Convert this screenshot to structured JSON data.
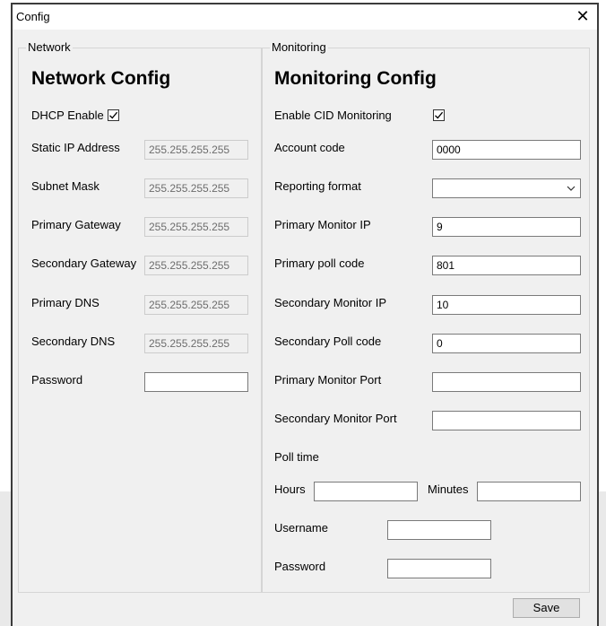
{
  "window": {
    "title": "Config"
  },
  "network": {
    "group_label": "Network",
    "heading": "Network Config",
    "dhcp_label": "DHCP Enable",
    "dhcp_checked": true,
    "fields": [
      {
        "label": "Static IP Address",
        "value": "255.255.255.255"
      },
      {
        "label": "Subnet Mask",
        "value": "255.255.255.255"
      },
      {
        "label": "Primary Gateway",
        "value": "255.255.255.255"
      },
      {
        "label": "Secondary Gateway",
        "value": "255.255.255.255"
      },
      {
        "label": "Primary DNS",
        "value": "255.255.255.255"
      },
      {
        "label": "Secondary DNS",
        "value": "255.255.255.255"
      },
      {
        "label": "Password",
        "value": ""
      }
    ]
  },
  "monitoring": {
    "group_label": "Monitoring",
    "heading": "Monitoring Config",
    "enable_cid_label": "Enable CID Monitoring",
    "enable_cid_checked": true,
    "account_code_label": "Account code",
    "account_code_value": "0000",
    "reporting_format_label": "Reporting format",
    "reporting_format_value": "",
    "primary_monitor_ip_label": "Primary Monitor IP",
    "primary_monitor_ip_value": "9",
    "primary_poll_code_label": "Primary poll code",
    "primary_poll_code_value": "801",
    "secondary_monitor_ip_label": "Secondary Monitor IP",
    "secondary_monitor_ip_value": "10",
    "secondary_poll_code_label": "Secondary Poll code",
    "secondary_poll_code_value": "0",
    "primary_monitor_port_label": "Primary Monitor Port",
    "primary_monitor_port_value": "",
    "secondary_monitor_port_label": "Secondary Monitor Port",
    "secondary_monitor_port_value": "",
    "poll_time_label": "Poll time",
    "hours_label": "Hours",
    "hours_value": "",
    "minutes_label": "Minutes",
    "minutes_value": "",
    "username_label": "Username",
    "username_value": "",
    "password_label": "Password",
    "password_value": ""
  },
  "footer": {
    "save_label": "Save"
  },
  "icons": {
    "close": "close-icon",
    "check": "checkmark-icon",
    "dropdown": "chevron-down-icon"
  }
}
